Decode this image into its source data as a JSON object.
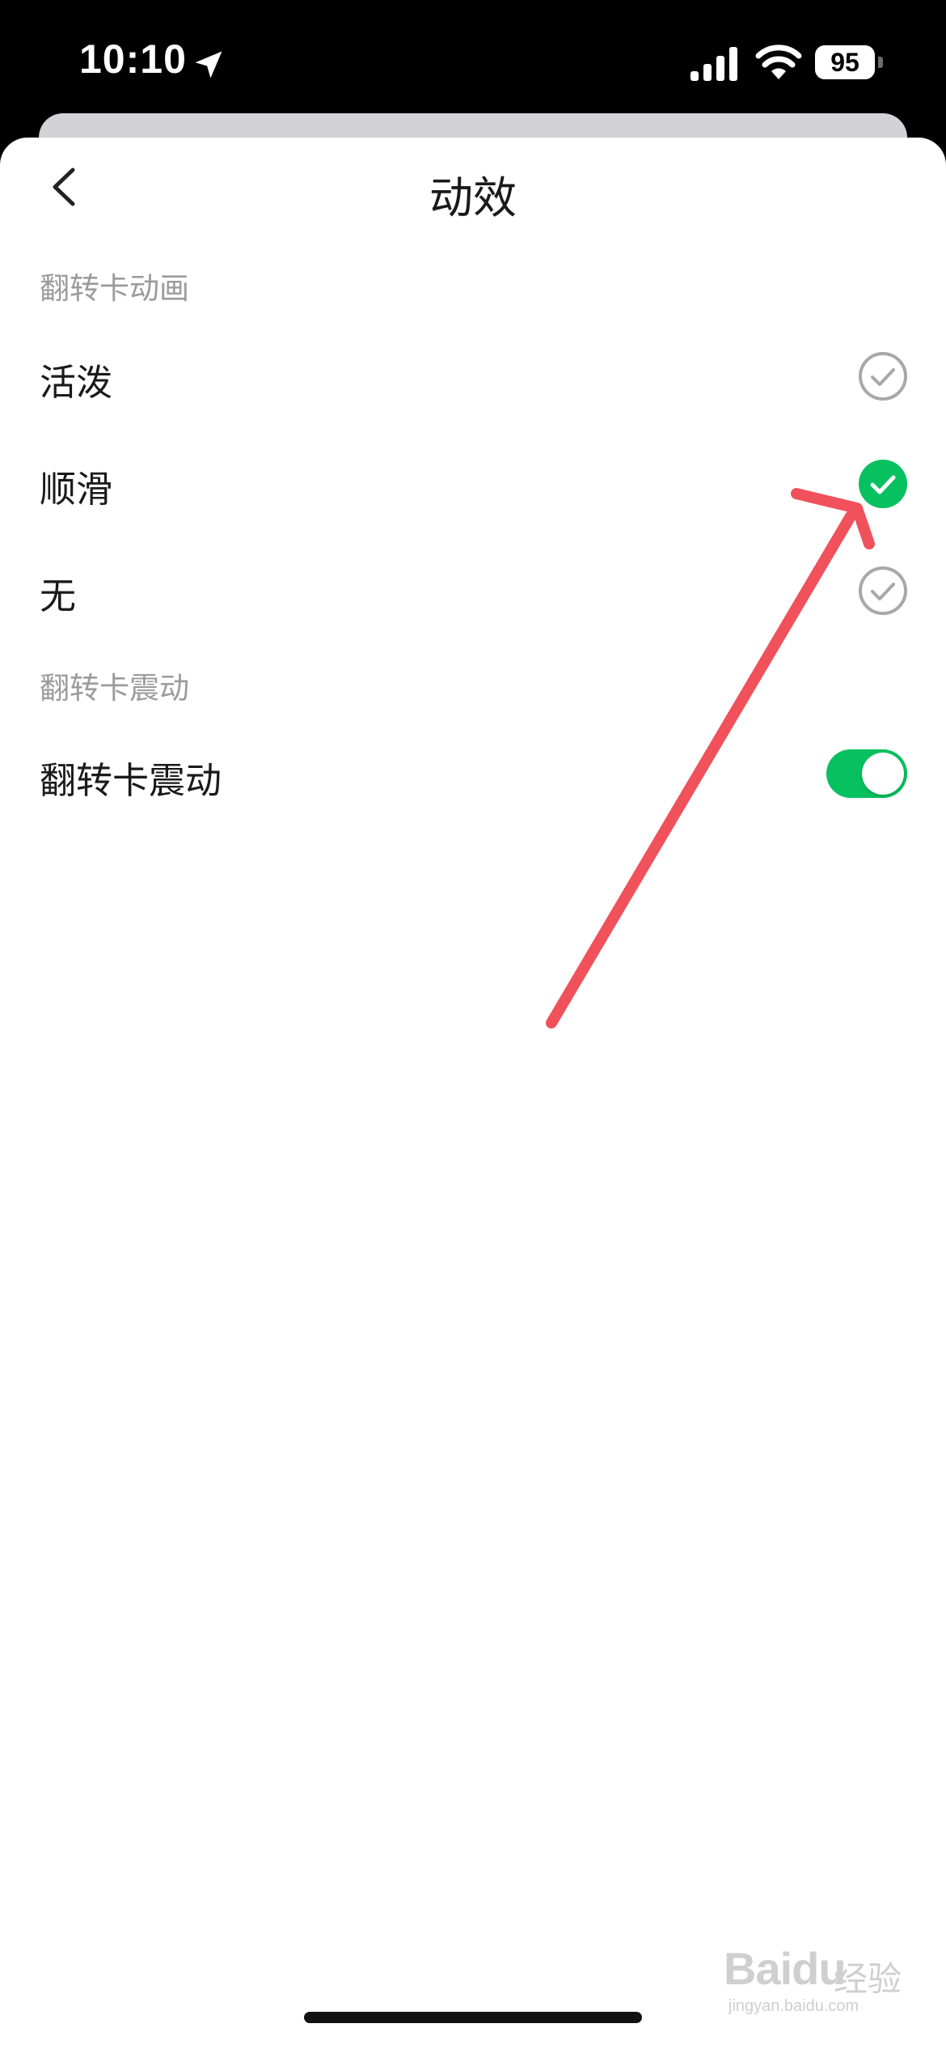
{
  "status_bar": {
    "time": "10:10",
    "battery": "95"
  },
  "header": {
    "title": "动效"
  },
  "sections": [
    {
      "header": "翻转卡动画",
      "options": [
        {
          "label": "活泼",
          "selected": false
        },
        {
          "label": "顺滑",
          "selected": true
        },
        {
          "label": "无",
          "selected": false
        }
      ]
    },
    {
      "header": "翻转卡震动",
      "toggle": {
        "label": "翻转卡震动",
        "on": true
      }
    }
  ],
  "colors": {
    "accent": "#07c160",
    "annotation": "#f0515a"
  },
  "watermark": {
    "logo": "Baidu",
    "cn": "经验",
    "url": "jingyan.baidu.com"
  }
}
